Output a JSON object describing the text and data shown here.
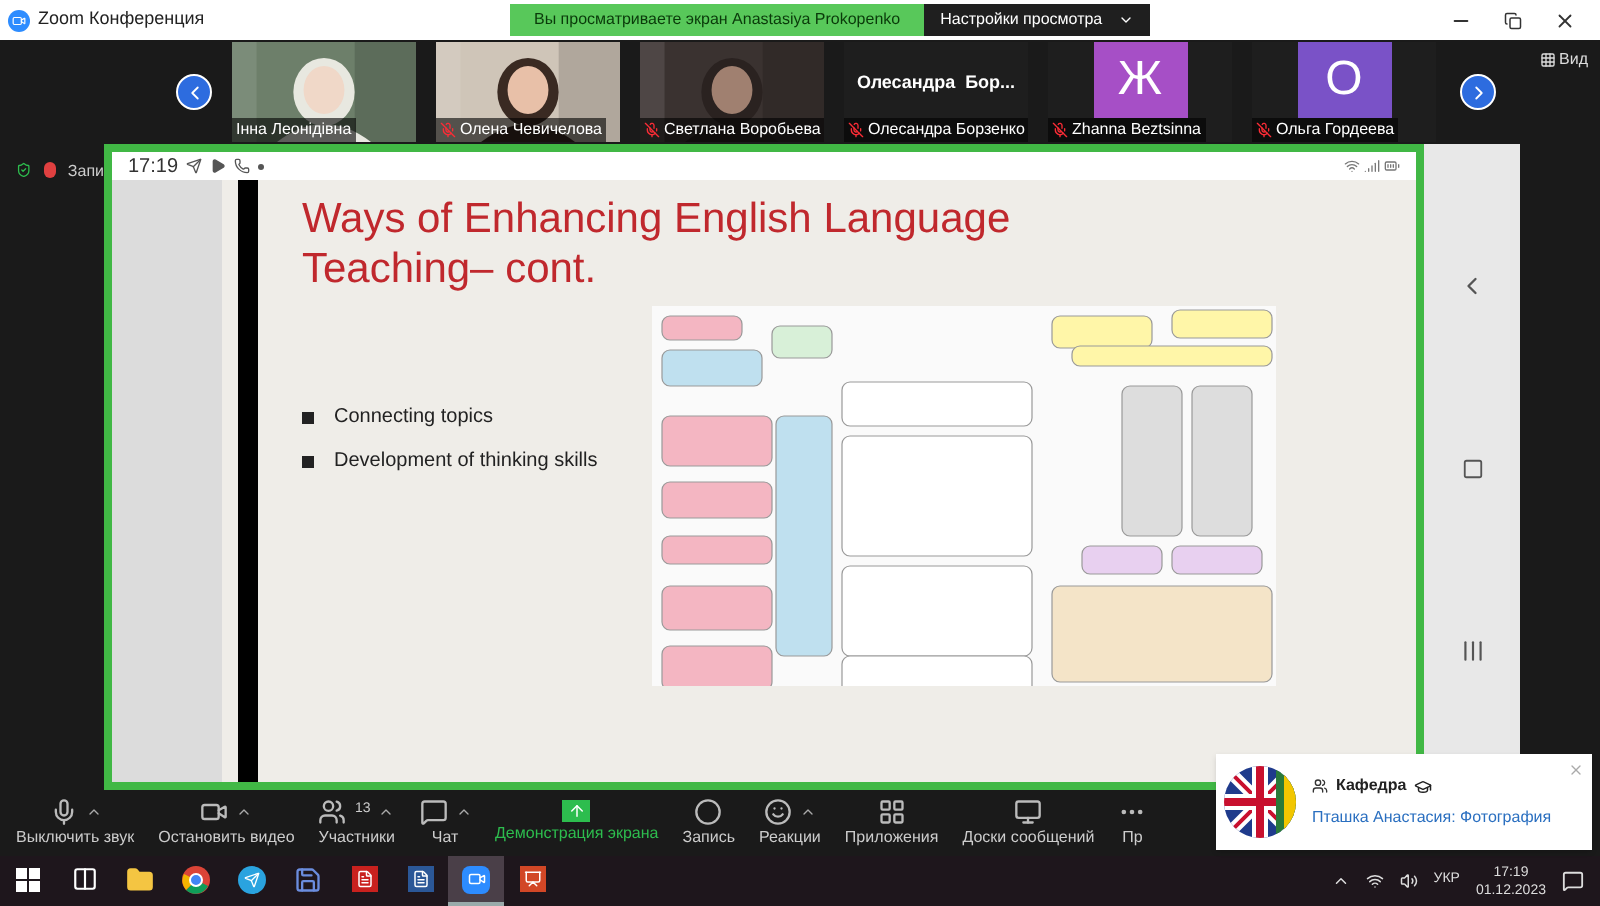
{
  "window": {
    "title": "Zoom Конференция"
  },
  "share_banner": {
    "text": "Вы просматриваете экран Anastasiya Prokopenko",
    "settings": "Настройки просмотра"
  },
  "view_button": "Вид",
  "participants": [
    {
      "kind": "video",
      "name": "Інна Леонідівна",
      "muted": false
    },
    {
      "kind": "video",
      "name": "Олена Чевичелова",
      "muted": true
    },
    {
      "kind": "video",
      "name": "Светлана Воробьева",
      "muted": true
    },
    {
      "kind": "name",
      "display": "Олесандра  Бор...",
      "name": "Олесандра Борзенко",
      "muted": true
    },
    {
      "kind": "avatar",
      "initial": "Ж",
      "color": "#a64fc6",
      "name": "Zhanna Beztsinna",
      "muted": true
    },
    {
      "kind": "avatar",
      "initial": "О",
      "color": "#7a52c7",
      "name": "Ольга Гордеева",
      "muted": true
    }
  ],
  "recording_label": "Запи",
  "phone_status": {
    "time": "17:19"
  },
  "slide": {
    "title": "Ways of Enhancing English Language Teaching– cont.",
    "bullets": [
      "Connecting topics",
      "Development of thinking skills"
    ]
  },
  "toolbar": [
    {
      "kind": "mic",
      "label": "Выключить звук",
      "caret": true
    },
    {
      "kind": "video",
      "label": "Остановить видео",
      "caret": true
    },
    {
      "kind": "participants",
      "label": "Участники",
      "count": "13",
      "caret": true
    },
    {
      "kind": "chat",
      "label": "Чат",
      "caret": true
    },
    {
      "kind": "share",
      "label": "Демонстрация экрана",
      "caret": false
    },
    {
      "kind": "record",
      "label": "Запись",
      "caret": false
    },
    {
      "kind": "reactions",
      "label": "Реакции",
      "caret": true
    },
    {
      "kind": "apps",
      "label": "Приложения",
      "caret": false
    },
    {
      "kind": "whiteboard",
      "label": "Доски сообщений",
      "caret": false
    },
    {
      "kind": "more",
      "label": "Пр",
      "caret": false
    }
  ],
  "notification": {
    "title": "Кафедра",
    "message": "Пташка Анастасия: Фотография"
  },
  "taskbar": {
    "apps": [
      {
        "kind": "start",
        "active": false
      },
      {
        "kind": "taskview",
        "active": false
      },
      {
        "kind": "explorer",
        "active": false
      },
      {
        "kind": "chrome",
        "active": false
      },
      {
        "kind": "telegram",
        "active": false
      },
      {
        "kind": "save",
        "active": false
      },
      {
        "kind": "acrobat",
        "active": false
      },
      {
        "kind": "word",
        "active": false
      },
      {
        "kind": "zoom",
        "active": true
      },
      {
        "kind": "powerpoint",
        "active": false
      }
    ],
    "language": "УКР",
    "time": "17:19",
    "date": "01.12.2023"
  }
}
